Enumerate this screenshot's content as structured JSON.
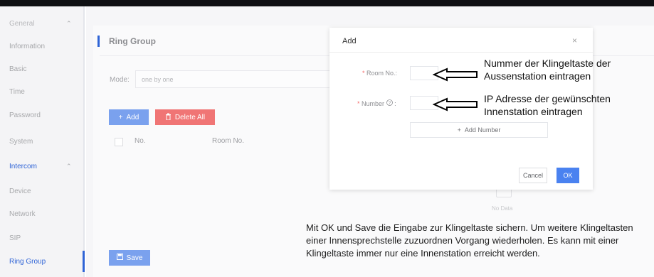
{
  "sidebar": {
    "items": [
      {
        "label": "General",
        "chevron": "⌃"
      },
      {
        "label": "Information"
      },
      {
        "label": "Basic"
      },
      {
        "label": "Time"
      },
      {
        "label": "Password"
      },
      {
        "label": "System"
      },
      {
        "label": "Intercom",
        "chevron": "⌃"
      },
      {
        "label": "Device"
      },
      {
        "label": "Network"
      },
      {
        "label": "SIP"
      },
      {
        "label": "Ring Group"
      }
    ]
  },
  "panel": {
    "title": "Ring Group",
    "mode_label": "Mode:",
    "mode_value": "one by one",
    "add_button": "Add",
    "delete_all_button": "Delete All",
    "columns": [
      "No.",
      "Room No."
    ],
    "no_data": "No Data",
    "save_button": "Save"
  },
  "dialog": {
    "title": "Add",
    "close_glyph": "×",
    "room_no_label": "Room No.:",
    "number_label": "Number",
    "add_number_button": "Add Number",
    "cancel_button": "Cancel",
    "ok_button": "OK"
  },
  "annotations": {
    "room_line1": "Nummer der Klingeltaste der",
    "room_line2": "Aussenstation eintragen",
    "number_line1": "IP Adresse der gewünschten",
    "number_line2": "Innenstation eintragen",
    "note": "Mit OK und Save die Eingabe zur Klingeltaste sichern. Um weitere Klingeltasten einer Innensprechstelle zuzuordnen Vorgang wiederholen. Es kann mit einer Klingeltaste immer nur eine Innenstation erreicht werden."
  },
  "colors": {
    "accent": "#2f64d6",
    "primary_button": "#4a82f0",
    "danger_button": "#f07575",
    "required_star": "#f56c6c"
  }
}
